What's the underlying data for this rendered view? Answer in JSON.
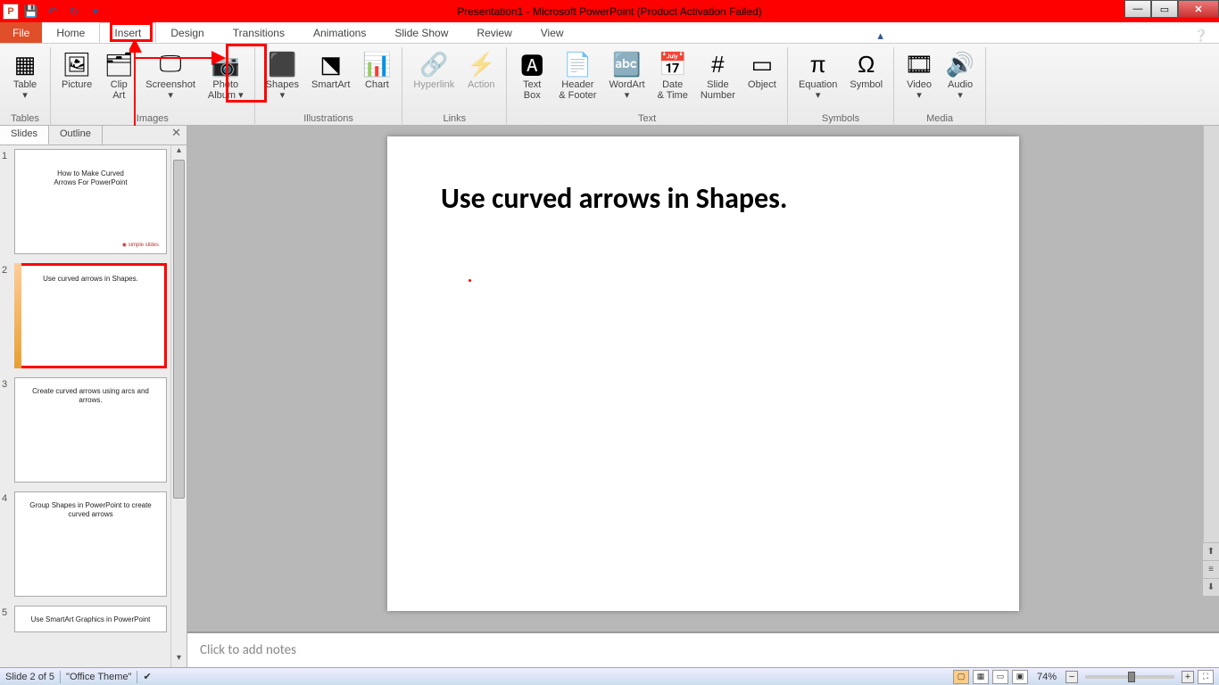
{
  "titlebar": {
    "title": "Presentation1 - Microsoft PowerPoint (Product Activation Failed)"
  },
  "tabs": {
    "file": "File",
    "items": [
      "Home",
      "Insert",
      "Design",
      "Transitions",
      "Animations",
      "Slide Show",
      "Review",
      "View"
    ],
    "active": "Insert"
  },
  "ribbon": {
    "groups": [
      {
        "label": "Tables",
        "items": [
          {
            "n": "table",
            "lbl": "Table\n▾",
            "ico": "▦"
          }
        ]
      },
      {
        "label": "Images",
        "items": [
          {
            "n": "picture",
            "lbl": "Picture",
            "ico": "🖼"
          },
          {
            "n": "clipart",
            "lbl": "Clip\nArt",
            "ico": "🗂"
          },
          {
            "n": "screenshot",
            "lbl": "Screenshot\n▾",
            "ico": "🖵"
          },
          {
            "n": "photoalbum",
            "lbl": "Photo\nAlbum ▾",
            "ico": "📷"
          }
        ]
      },
      {
        "label": "Illustrations",
        "items": [
          {
            "n": "shapes",
            "lbl": "Shapes\n▾",
            "ico": "◻"
          },
          {
            "n": "smartart",
            "lbl": "SmartArt",
            "ico": "⬔"
          },
          {
            "n": "chart",
            "lbl": "Chart",
            "ico": "📊"
          }
        ]
      },
      {
        "label": "Links",
        "items": [
          {
            "n": "hyperlink",
            "lbl": "Hyperlink",
            "ico": "🔗",
            "dis": true
          },
          {
            "n": "action",
            "lbl": "Action",
            "ico": "⚡",
            "dis": true
          }
        ]
      },
      {
        "label": "Text",
        "items": [
          {
            "n": "textbox",
            "lbl": "Text\nBox",
            "ico": "🅰"
          },
          {
            "n": "headerfooter",
            "lbl": "Header\n& Footer",
            "ico": "📄"
          },
          {
            "n": "wordart",
            "lbl": "WordArt\n▾",
            "ico": "🔤"
          },
          {
            "n": "datetime",
            "lbl": "Date\n& Time",
            "ico": "📅"
          },
          {
            "n": "slidenumber",
            "lbl": "Slide\nNumber",
            "ico": "#"
          },
          {
            "n": "object",
            "lbl": "Object",
            "ico": "▭"
          }
        ]
      },
      {
        "label": "Symbols",
        "items": [
          {
            "n": "equation",
            "lbl": "Equation\n▾",
            "ico": "π"
          },
          {
            "n": "symbol",
            "lbl": "Symbol",
            "ico": "Ω"
          }
        ]
      },
      {
        "label": "Media",
        "items": [
          {
            "n": "video",
            "lbl": "Video\n▾",
            "ico": "🎞"
          },
          {
            "n": "audio",
            "lbl": "Audio\n▾",
            "ico": "🔊"
          }
        ]
      }
    ]
  },
  "sidepanel": {
    "tabs": {
      "slides": "Slides",
      "outline": "Outline"
    },
    "thumbs": [
      {
        "num": "1",
        "title": "How to Make Curved\nArrows For PowerPoint",
        "logo": "◉ simple slides",
        "centered": true
      },
      {
        "num": "2",
        "title": "Use curved arrows in Shapes.",
        "selected": true
      },
      {
        "num": "3",
        "title": "Create curved arrows using arcs and\narrows."
      },
      {
        "num": "4",
        "title": "Group Shapes in PowerPoint to create\ncurved arrows"
      },
      {
        "num": "5",
        "title": "Use SmartArt Graphics in PowerPoint"
      }
    ]
  },
  "slide": {
    "title": "Use curved arrows in Shapes."
  },
  "notes": {
    "placeholder": "Click to add notes"
  },
  "status": {
    "slide": "Slide 2 of 5",
    "theme": "\"Office Theme\"",
    "zoom": "74%"
  }
}
